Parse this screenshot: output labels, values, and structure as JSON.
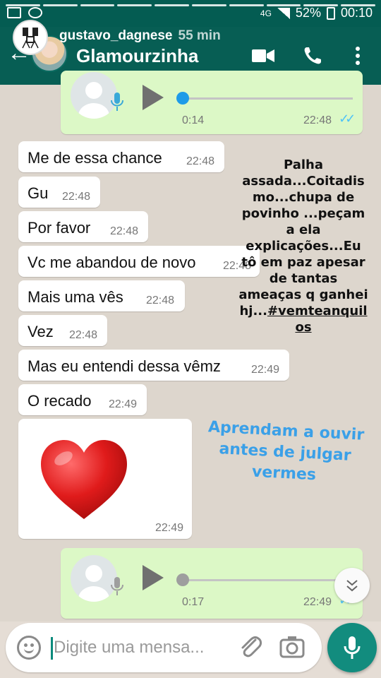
{
  "status_bar": {
    "battery": "52%",
    "time": "00:10",
    "network": "4G"
  },
  "story": {
    "username": "gustavo_dagnese",
    "posted_ago": "55 min"
  },
  "chat": {
    "contact_name": "Glamourzinha"
  },
  "audio_messages": [
    {
      "duration": "0:14",
      "time": "22:48",
      "read": true,
      "progress": 0.0
    },
    {
      "duration": "0:17",
      "time": "22:49",
      "read": true,
      "progress": 0.0
    }
  ],
  "messages": [
    {
      "text": "Me de essa chance",
      "time": "22:48"
    },
    {
      "text": "Gu",
      "time": "22:48"
    },
    {
      "text": "Por favor",
      "time": "22:48"
    },
    {
      "text": "Vc me abandou de novo",
      "time": "22:48"
    },
    {
      "text": "Mais uma vês",
      "time": "22:48"
    },
    {
      "text": "Vez",
      "time": "22:48"
    },
    {
      "text": "Mas eu entendi dessa vêmz",
      "time": "22:49"
    },
    {
      "text": "O recado",
      "time": "22:49"
    }
  ],
  "heart_message": {
    "emoji": "❤️",
    "time": "22:49"
  },
  "overlay": {
    "black_lines": [
      "Palha",
      "assada...Coitadis",
      "mo...chupa de",
      "povinho ...peçam",
      "a ela",
      "explicações...Eu",
      "tô em paz apesar",
      "de tantas",
      "ameaças q ganhei",
      "hj...#vemteanquil",
      "os"
    ],
    "blue_lines": [
      "Aprendam a ouvir",
      "antes de julgar",
      "vermes"
    ]
  },
  "input": {
    "placeholder": "Digite uma mensa..."
  },
  "colors": {
    "header": "#075e54",
    "status": "#045c52",
    "accent": "#128c7e",
    "outgoing": "#dcf8c6",
    "read_ticks": "#4fc3f7",
    "overlay_blue": "#3aa0e8"
  }
}
